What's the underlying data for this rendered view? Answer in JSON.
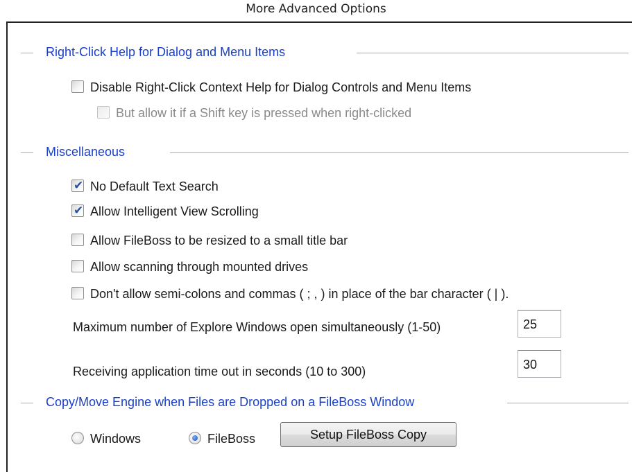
{
  "title": "More Advanced Options",
  "sections": {
    "right_click": {
      "title": "Right-Click Help for Dialog and Menu Items"
    },
    "misc": {
      "title": "Miscellaneous"
    },
    "copy_move": {
      "title": "Copy/Move Engine when Files are Dropped on a FileBoss Window"
    }
  },
  "options": {
    "disable_context_help": {
      "label": "Disable Right-Click Context Help for Dialog Controls and Menu Items",
      "checked": false,
      "enabled": true
    },
    "allow_shift": {
      "label": "But allow it if a Shift key is pressed when right-clicked",
      "checked": false,
      "enabled": false
    },
    "no_default_search": {
      "label": "No Default Text Search",
      "checked": true,
      "enabled": true
    },
    "intelligent_scrolling": {
      "label": "Allow Intelligent View Scrolling",
      "checked": true,
      "enabled": true
    },
    "resize_title_bar": {
      "label": "Allow FileBoss to be resized to a small title bar",
      "checked": false,
      "enabled": true
    },
    "scan_mounted": {
      "label": "Allow scanning through mounted drives",
      "checked": false,
      "enabled": true
    },
    "semicolons": {
      "label": "Don't allow semi-colons and commas ( ; , ) in place of the bar character ( | ).",
      "checked": false,
      "enabled": true
    }
  },
  "fields": {
    "max_windows": {
      "label": "Maximum number of Explore Windows open simultaneously (1-50)",
      "value": "25"
    },
    "timeout": {
      "label": "Receiving application time out in seconds (10 to 300)",
      "value": "30"
    }
  },
  "copy_engine": {
    "selected": "fileboss",
    "windows_label": "Windows",
    "fileboss_label": "FileBoss",
    "setup_button": "Setup FileBoss Copy"
  },
  "icons": {
    "check": "checkmark-icon",
    "radio": "radio-dot-icon"
  },
  "colors": {
    "section_title": "#1b3fc6",
    "checkmark": "#2a4f9c",
    "radio_dot": "#1d4fb5"
  }
}
